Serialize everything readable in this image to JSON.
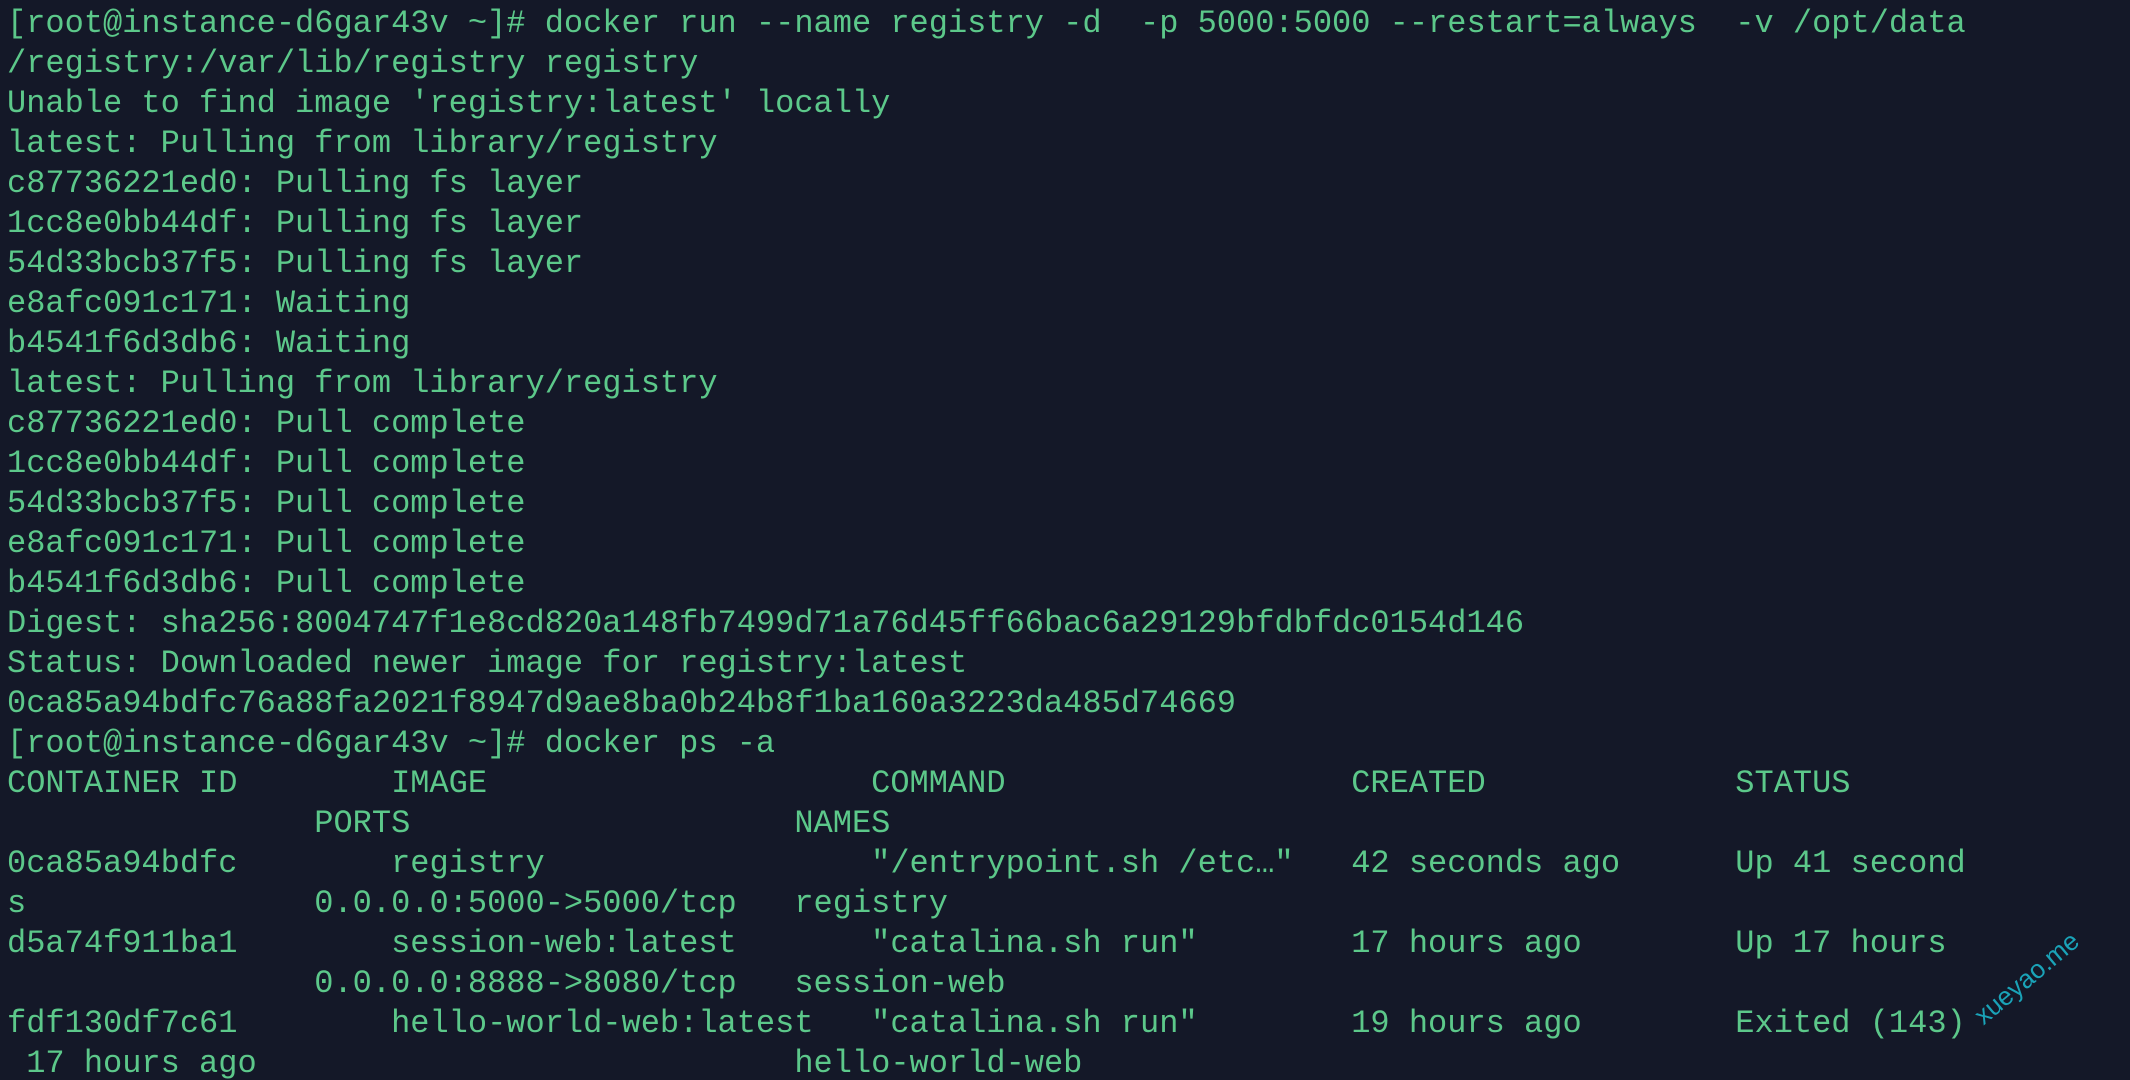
{
  "terminal": {
    "colors": {
      "background": "#141828",
      "foreground": "#5cc88a",
      "watermark": "#1aa3b8"
    },
    "lines": [
      "[root@instance-d6gar43v ~]# docker run --name registry -d  -p 5000:5000 --restart=always  -v /opt/data",
      "/registry:/var/lib/registry registry",
      "Unable to find image 'registry:latest' locally",
      "latest: Pulling from library/registry",
      "c87736221ed0: Pulling fs layer",
      "1cc8e0bb44df: Pulling fs layer",
      "54d33bcb37f5: Pulling fs layer",
      "e8afc091c171: Waiting",
      "b4541f6d3db6: Waiting",
      "latest: Pulling from library/registry",
      "c87736221ed0: Pull complete",
      "1cc8e0bb44df: Pull complete",
      "54d33bcb37f5: Pull complete",
      "e8afc091c171: Pull complete",
      "b4541f6d3db6: Pull complete",
      "Digest: sha256:8004747f1e8cd820a148fb7499d71a76d45ff66bac6a29129bfdbfdc0154d146",
      "Status: Downloaded newer image for registry:latest",
      "0ca85a94bdfc76a88fa2021f8947d9ae8ba0b24b8f1ba160a3223da485d74669",
      "[root@instance-d6gar43v ~]# docker ps -a",
      "CONTAINER ID        IMAGE                    COMMAND                  CREATED             STATUS",
      "                PORTS                    NAMES",
      "0ca85a94bdfc        registry                 \"/entrypoint.sh /etc…\"   42 seconds ago      Up 41 second",
      "s               0.0.0.0:5000->5000/tcp   registry",
      "d5a74f911ba1        session-web:latest       \"catalina.sh run\"        17 hours ago        Up 17 hours",
      "                0.0.0.0:8888->8080/tcp   session-web",
      "fdf130df7c61        hello-world-web:latest   \"catalina.sh run\"        19 hours ago        Exited (143)",
      " 17 hours ago                            hello-world-web"
    ]
  },
  "watermark": {
    "text": "xueyao.me"
  }
}
